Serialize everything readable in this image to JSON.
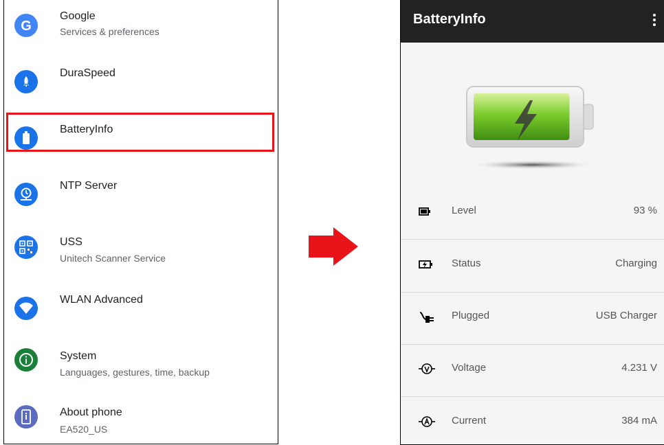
{
  "settings": {
    "items": [
      {
        "title": "Google",
        "subtitle": "Services & preferences",
        "icon": "google-icon",
        "color": "#4285f4"
      },
      {
        "title": "DuraSpeed",
        "subtitle": "",
        "icon": "rocket-icon",
        "color": "#1a73e8"
      },
      {
        "title": "BatteryInfo",
        "subtitle": "",
        "icon": "battery-icon",
        "color": "#1a73e8"
      },
      {
        "title": "NTP Server",
        "subtitle": "",
        "icon": "clock-icon",
        "color": "#1a73e8"
      },
      {
        "title": "USS",
        "subtitle": "Unitech Scanner Service",
        "icon": "qr-code-icon",
        "color": "#1a73e8"
      },
      {
        "title": "WLAN Advanced",
        "subtitle": "",
        "icon": "wifi-icon",
        "color": "#1a73e8"
      },
      {
        "title": "System",
        "subtitle": "Languages, gestures, time, backup",
        "icon": "info-icon",
        "color": "#188038"
      },
      {
        "title": "About phone",
        "subtitle": "EA520_US",
        "icon": "phone-icon",
        "color": "#5b6bc0"
      }
    ],
    "highlight_color": "#e8141a"
  },
  "arrow": {
    "color": "#e8141a"
  },
  "battery_app": {
    "title": "BatteryInfo",
    "level_fraction": 0.93,
    "rows": [
      {
        "label": "Level",
        "value": "93 %",
        "icon": "battery-level-icon"
      },
      {
        "label": "Status",
        "value": "Charging",
        "icon": "battery-charging-icon"
      },
      {
        "label": "Plugged",
        "value": "USB Charger",
        "icon": "plug-icon"
      },
      {
        "label": "Voltage",
        "value": "4.231 V",
        "icon": "voltage-icon"
      },
      {
        "label": "Current",
        "value": "384 mA",
        "icon": "current-icon"
      }
    ]
  }
}
